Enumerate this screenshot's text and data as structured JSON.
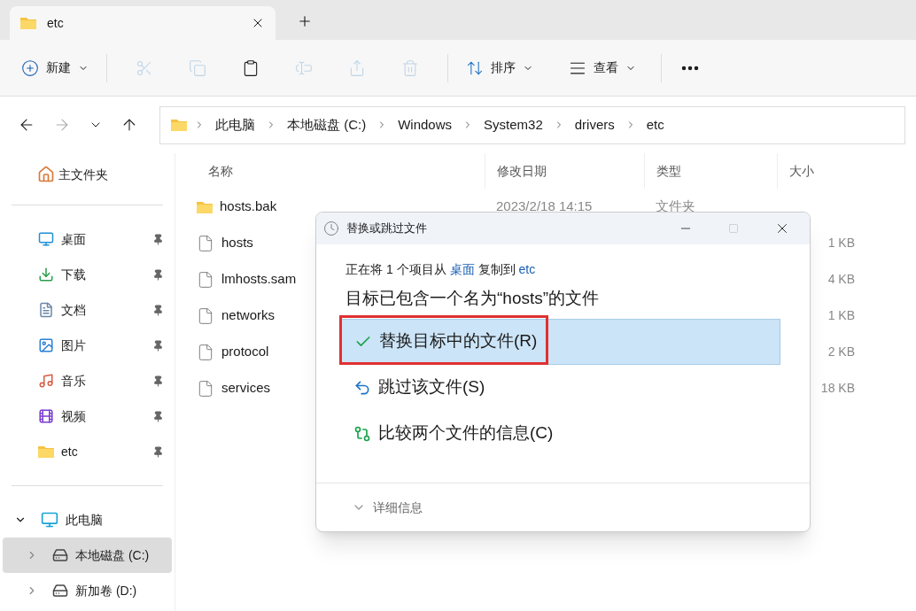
{
  "tab": {
    "title": "etc"
  },
  "toolbar": {
    "new_label": "新建",
    "actions": [
      {
        "kind": "cut",
        "disabled": true
      },
      {
        "kind": "copy",
        "disabled": true
      },
      {
        "kind": "paste",
        "disabled": false
      },
      {
        "kind": "rename",
        "disabled": true
      },
      {
        "kind": "share",
        "disabled": true
      },
      {
        "kind": "delete",
        "disabled": true
      }
    ],
    "sort_label": "排序",
    "view_label": "查看"
  },
  "breadcrumb": [
    "此电脑",
    "本地磁盘 (C:)",
    "Windows",
    "System32",
    "drivers",
    "etc"
  ],
  "sidebar": {
    "home": "主文件夹",
    "pinned": [
      {
        "kind": "desktop",
        "label": "桌面"
      },
      {
        "kind": "download",
        "label": "下载"
      },
      {
        "kind": "document",
        "label": "文档"
      },
      {
        "kind": "picture",
        "label": "图片"
      },
      {
        "kind": "music",
        "label": "音乐"
      },
      {
        "kind": "video",
        "label": "视频"
      },
      {
        "kind": "folder",
        "label": "etc"
      }
    ],
    "this_pc": {
      "label": "此电脑",
      "expanded": true,
      "drives": [
        {
          "label": "本地磁盘 (C:)",
          "selected": true
        },
        {
          "label": "新加卷 (D:)",
          "selected": false
        }
      ]
    }
  },
  "table": {
    "columns": [
      "名称",
      "修改日期",
      "类型",
      "大小"
    ],
    "rows": [
      {
        "kind": "folder",
        "name": "hosts.bak",
        "date": "2023/2/18 14:15",
        "type": "文件夹"
      },
      {
        "kind": "file",
        "name": "hosts",
        "size": "1 KB"
      },
      {
        "kind": "file",
        "name": "lmhosts.sam",
        "size": "4 KB"
      },
      {
        "kind": "file",
        "name": "networks",
        "size": "1 KB"
      },
      {
        "kind": "file",
        "name": "protocol",
        "size": "2 KB"
      },
      {
        "kind": "file",
        "name": "services",
        "size": "18 KB"
      }
    ]
  },
  "dialog": {
    "title": "替换或跳过文件",
    "info": {
      "prefix": "正在将 1 个项目从",
      "source": "桌面",
      "middle": "复制到",
      "destination": "etc"
    },
    "heading": "目标已包含一个名为“hosts”的文件",
    "options": [
      {
        "kind": "replace",
        "label": "替换目标中的文件(R)",
        "selected": true,
        "outlined": true
      },
      {
        "kind": "skip",
        "label": "跳过该文件(S)",
        "selected": false,
        "outlined": false
      },
      {
        "kind": "compare",
        "label": "比较两个文件的信息(C)",
        "selected": false,
        "outlined": false
      }
    ],
    "details_label": "详细信息"
  }
}
